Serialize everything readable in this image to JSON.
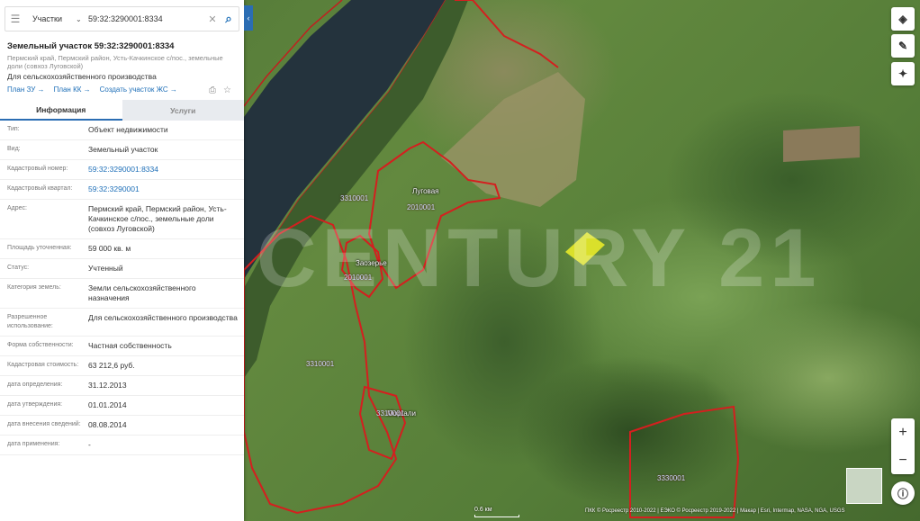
{
  "search": {
    "category": "Участки",
    "query": "59:32:3290001:8334"
  },
  "parcel": {
    "title": "Земельный участок 59:32:3290001:8334",
    "address": "Пермский край, Пермский район, Усть-Качкинское с/пос., земельные доли (совхоз Луговской)",
    "usage": "Для сельскохозяйственного производства",
    "links": [
      "План ЗУ →",
      "План КК →",
      "Создать участок ЖС →"
    ]
  },
  "tabs": {
    "info": "Информация",
    "services": "Услуги"
  },
  "rows": [
    {
      "k": "Тип:",
      "v": "Объект недвижимости"
    },
    {
      "k": "Вид:",
      "v": "Земельный участок"
    },
    {
      "k": "Кадастровый номер:",
      "v": "59:32:3290001:8334"
    },
    {
      "k": "Кадастровый квартал:",
      "v": "59:32:3290001"
    },
    {
      "k": "Адрес:",
      "v": "Пермский край, Пермский район, Усть-Качкинское с/пос., земельные доли (совхоз Луговской)"
    },
    {
      "k": "Площадь уточненная:",
      "v": "59 000 кв. м"
    },
    {
      "k": "Статус:",
      "v": "Учтенный"
    },
    {
      "k": "Категория земель:",
      "v": "Земли сельскохозяйственного назначения"
    },
    {
      "k": "Разрешенное использование:",
      "v": "Для сельскохозяйственного производства"
    },
    {
      "k": "Форма собственности:",
      "v": "Частная собственность"
    },
    {
      "k": "Кадастровая стоимость:",
      "v": "63 212,6 руб."
    },
    {
      "k": "дата определения:",
      "v": "31.12.2013"
    },
    {
      "k": "дата утверждения:",
      "v": "01.01.2014"
    },
    {
      "k": "дата внесения сведений:",
      "v": "08.08.2014"
    },
    {
      "k": "дата применения:",
      "v": "-"
    }
  ],
  "map": {
    "watermark": "CENTURY 21",
    "places": [
      "Луговая",
      "Заозерье",
      "Моргали"
    ],
    "zones": [
      "3310001",
      "2010001",
      "2010001",
      "3310001",
      "3310001",
      "3330001"
    ],
    "scale": "0.6 км",
    "attribution": "ПКК © Росреестр 2010-2022 | ЕЭКО © Росреестр 2019-2022 | Макар | Esri, Intermap, NASA, NGA, USGS",
    "highlight_color": "#f0f028",
    "boundary_color": "#d41f1f"
  }
}
